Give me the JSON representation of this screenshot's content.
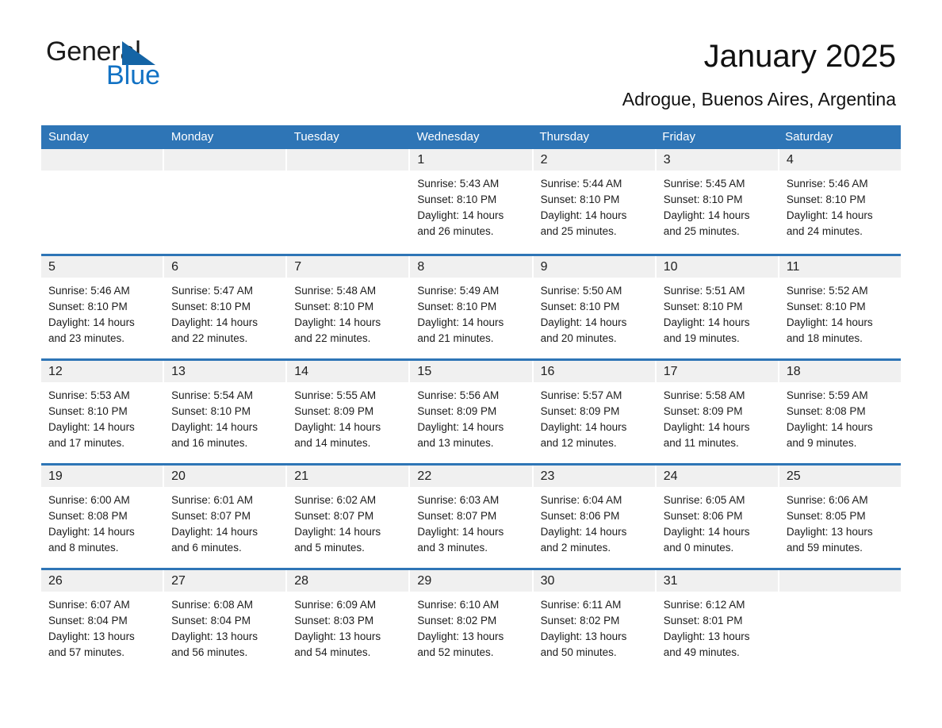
{
  "logo": {
    "word1": "General",
    "word2": "Blue",
    "triangle_color": "#1464a5",
    "blue_color": "#1272c4"
  },
  "header": {
    "title": "January 2025",
    "location": "Adrogue, Buenos Aires, Argentina"
  },
  "theme": {
    "header_blue": "#2e75b6",
    "daynum_band": "#f0f0f0",
    "text": "#1c1c1c"
  },
  "weekdays": [
    "Sunday",
    "Monday",
    "Tuesday",
    "Wednesday",
    "Thursday",
    "Friday",
    "Saturday"
  ],
  "weeks": [
    [
      {
        "day": "",
        "sunrise": "",
        "sunset": "",
        "daylight1": "",
        "daylight2": ""
      },
      {
        "day": "",
        "sunrise": "",
        "sunset": "",
        "daylight1": "",
        "daylight2": ""
      },
      {
        "day": "",
        "sunrise": "",
        "sunset": "",
        "daylight1": "",
        "daylight2": ""
      },
      {
        "day": "1",
        "sunrise": "Sunrise: 5:43 AM",
        "sunset": "Sunset: 8:10 PM",
        "daylight1": "Daylight: 14 hours",
        "daylight2": "and 26 minutes."
      },
      {
        "day": "2",
        "sunrise": "Sunrise: 5:44 AM",
        "sunset": "Sunset: 8:10 PM",
        "daylight1": "Daylight: 14 hours",
        "daylight2": "and 25 minutes."
      },
      {
        "day": "3",
        "sunrise": "Sunrise: 5:45 AM",
        "sunset": "Sunset: 8:10 PM",
        "daylight1": "Daylight: 14 hours",
        "daylight2": "and 25 minutes."
      },
      {
        "day": "4",
        "sunrise": "Sunrise: 5:46 AM",
        "sunset": "Sunset: 8:10 PM",
        "daylight1": "Daylight: 14 hours",
        "daylight2": "and 24 minutes."
      }
    ],
    [
      {
        "day": "5",
        "sunrise": "Sunrise: 5:46 AM",
        "sunset": "Sunset: 8:10 PM",
        "daylight1": "Daylight: 14 hours",
        "daylight2": "and 23 minutes."
      },
      {
        "day": "6",
        "sunrise": "Sunrise: 5:47 AM",
        "sunset": "Sunset: 8:10 PM",
        "daylight1": "Daylight: 14 hours",
        "daylight2": "and 22 minutes."
      },
      {
        "day": "7",
        "sunrise": "Sunrise: 5:48 AM",
        "sunset": "Sunset: 8:10 PM",
        "daylight1": "Daylight: 14 hours",
        "daylight2": "and 22 minutes."
      },
      {
        "day": "8",
        "sunrise": "Sunrise: 5:49 AM",
        "sunset": "Sunset: 8:10 PM",
        "daylight1": "Daylight: 14 hours",
        "daylight2": "and 21 minutes."
      },
      {
        "day": "9",
        "sunrise": "Sunrise: 5:50 AM",
        "sunset": "Sunset: 8:10 PM",
        "daylight1": "Daylight: 14 hours",
        "daylight2": "and 20 minutes."
      },
      {
        "day": "10",
        "sunrise": "Sunrise: 5:51 AM",
        "sunset": "Sunset: 8:10 PM",
        "daylight1": "Daylight: 14 hours",
        "daylight2": "and 19 minutes."
      },
      {
        "day": "11",
        "sunrise": "Sunrise: 5:52 AM",
        "sunset": "Sunset: 8:10 PM",
        "daylight1": "Daylight: 14 hours",
        "daylight2": "and 18 minutes."
      }
    ],
    [
      {
        "day": "12",
        "sunrise": "Sunrise: 5:53 AM",
        "sunset": "Sunset: 8:10 PM",
        "daylight1": "Daylight: 14 hours",
        "daylight2": "and 17 minutes."
      },
      {
        "day": "13",
        "sunrise": "Sunrise: 5:54 AM",
        "sunset": "Sunset: 8:10 PM",
        "daylight1": "Daylight: 14 hours",
        "daylight2": "and 16 minutes."
      },
      {
        "day": "14",
        "sunrise": "Sunrise: 5:55 AM",
        "sunset": "Sunset: 8:09 PM",
        "daylight1": "Daylight: 14 hours",
        "daylight2": "and 14 minutes."
      },
      {
        "day": "15",
        "sunrise": "Sunrise: 5:56 AM",
        "sunset": "Sunset: 8:09 PM",
        "daylight1": "Daylight: 14 hours",
        "daylight2": "and 13 minutes."
      },
      {
        "day": "16",
        "sunrise": "Sunrise: 5:57 AM",
        "sunset": "Sunset: 8:09 PM",
        "daylight1": "Daylight: 14 hours",
        "daylight2": "and 12 minutes."
      },
      {
        "day": "17",
        "sunrise": "Sunrise: 5:58 AM",
        "sunset": "Sunset: 8:09 PM",
        "daylight1": "Daylight: 14 hours",
        "daylight2": "and 11 minutes."
      },
      {
        "day": "18",
        "sunrise": "Sunrise: 5:59 AM",
        "sunset": "Sunset: 8:08 PM",
        "daylight1": "Daylight: 14 hours",
        "daylight2": "and 9 minutes."
      }
    ],
    [
      {
        "day": "19",
        "sunrise": "Sunrise: 6:00 AM",
        "sunset": "Sunset: 8:08 PM",
        "daylight1": "Daylight: 14 hours",
        "daylight2": "and 8 minutes."
      },
      {
        "day": "20",
        "sunrise": "Sunrise: 6:01 AM",
        "sunset": "Sunset: 8:07 PM",
        "daylight1": "Daylight: 14 hours",
        "daylight2": "and 6 minutes."
      },
      {
        "day": "21",
        "sunrise": "Sunrise: 6:02 AM",
        "sunset": "Sunset: 8:07 PM",
        "daylight1": "Daylight: 14 hours",
        "daylight2": "and 5 minutes."
      },
      {
        "day": "22",
        "sunrise": "Sunrise: 6:03 AM",
        "sunset": "Sunset: 8:07 PM",
        "daylight1": "Daylight: 14 hours",
        "daylight2": "and 3 minutes."
      },
      {
        "day": "23",
        "sunrise": "Sunrise: 6:04 AM",
        "sunset": "Sunset: 8:06 PM",
        "daylight1": "Daylight: 14 hours",
        "daylight2": "and 2 minutes."
      },
      {
        "day": "24",
        "sunrise": "Sunrise: 6:05 AM",
        "sunset": "Sunset: 8:06 PM",
        "daylight1": "Daylight: 14 hours",
        "daylight2": "and 0 minutes."
      },
      {
        "day": "25",
        "sunrise": "Sunrise: 6:06 AM",
        "sunset": "Sunset: 8:05 PM",
        "daylight1": "Daylight: 13 hours",
        "daylight2": "and 59 minutes."
      }
    ],
    [
      {
        "day": "26",
        "sunrise": "Sunrise: 6:07 AM",
        "sunset": "Sunset: 8:04 PM",
        "daylight1": "Daylight: 13 hours",
        "daylight2": "and 57 minutes."
      },
      {
        "day": "27",
        "sunrise": "Sunrise: 6:08 AM",
        "sunset": "Sunset: 8:04 PM",
        "daylight1": "Daylight: 13 hours",
        "daylight2": "and 56 minutes."
      },
      {
        "day": "28",
        "sunrise": "Sunrise: 6:09 AM",
        "sunset": "Sunset: 8:03 PM",
        "daylight1": "Daylight: 13 hours",
        "daylight2": "and 54 minutes."
      },
      {
        "day": "29",
        "sunrise": "Sunrise: 6:10 AM",
        "sunset": "Sunset: 8:02 PM",
        "daylight1": "Daylight: 13 hours",
        "daylight2": "and 52 minutes."
      },
      {
        "day": "30",
        "sunrise": "Sunrise: 6:11 AM",
        "sunset": "Sunset: 8:02 PM",
        "daylight1": "Daylight: 13 hours",
        "daylight2": "and 50 minutes."
      },
      {
        "day": "31",
        "sunrise": "Sunrise: 6:12 AM",
        "sunset": "Sunset: 8:01 PM",
        "daylight1": "Daylight: 13 hours",
        "daylight2": "and 49 minutes."
      },
      {
        "day": "",
        "sunrise": "",
        "sunset": "",
        "daylight1": "",
        "daylight2": ""
      }
    ]
  ]
}
